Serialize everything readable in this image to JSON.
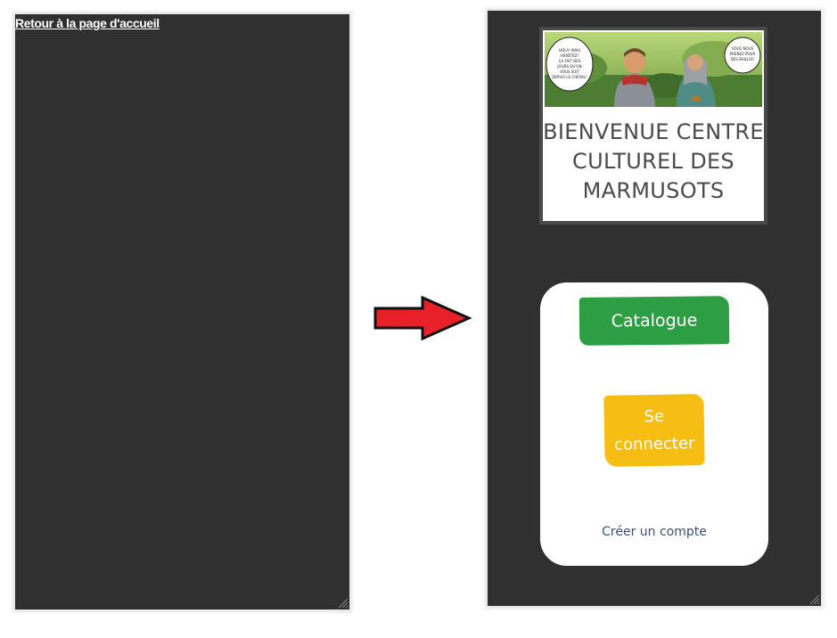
{
  "left_panel": {
    "back_link": "Retour à la page d'accueil"
  },
  "right_panel": {
    "banner": {
      "title": "BIENVENUE CENTRE CULTUREL DES MARMUSOTS",
      "bubble_left": "HOLÀ! MAIS ARRÊTEZ! ÇA FAIT DES JOURS QU'ON VOUS SUIT DEPUIS LE CHEVAL!",
      "bubble_right": "VOUS NOUS PRENEZ POUR DES BAILLIS?"
    },
    "card": {
      "catalogue_label": "Catalogue",
      "login_label": "Se connecter",
      "create_account_label": "Créer un compte"
    }
  },
  "colors": {
    "panel_bg": "#303030",
    "catalogue_green": "#2e9e45",
    "login_yellow": "#f6be13",
    "link_blue": "#3c4f7c",
    "arrow_red": "#e82028"
  },
  "icons": {
    "arrow": "red-right-arrow-icon",
    "resize": "resize-grip-icon"
  }
}
